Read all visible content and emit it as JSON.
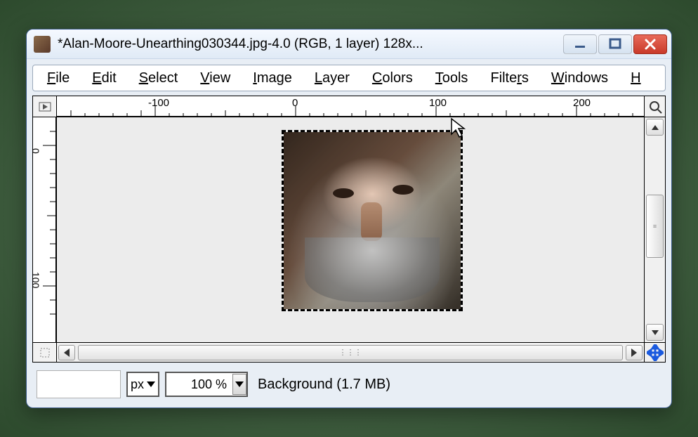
{
  "window": {
    "title": "*Alan-Moore-Unearthing030344.jpg-4.0 (RGB, 1 layer) 128x..."
  },
  "menu": {
    "file": "File",
    "edit": "Edit",
    "select": "Select",
    "view": "View",
    "image": "Image",
    "layer": "Layer",
    "colors": "Colors",
    "tools": "Tools",
    "filters": "Filters",
    "windows": "Windows",
    "help": "H"
  },
  "ruler": {
    "h_labels": [
      "-100",
      "0",
      "100",
      "200"
    ],
    "v_labels": [
      "0",
      "100"
    ]
  },
  "status": {
    "unit": "px",
    "zoom": "100 %",
    "layer_info": "Background (1.7 MB)"
  }
}
